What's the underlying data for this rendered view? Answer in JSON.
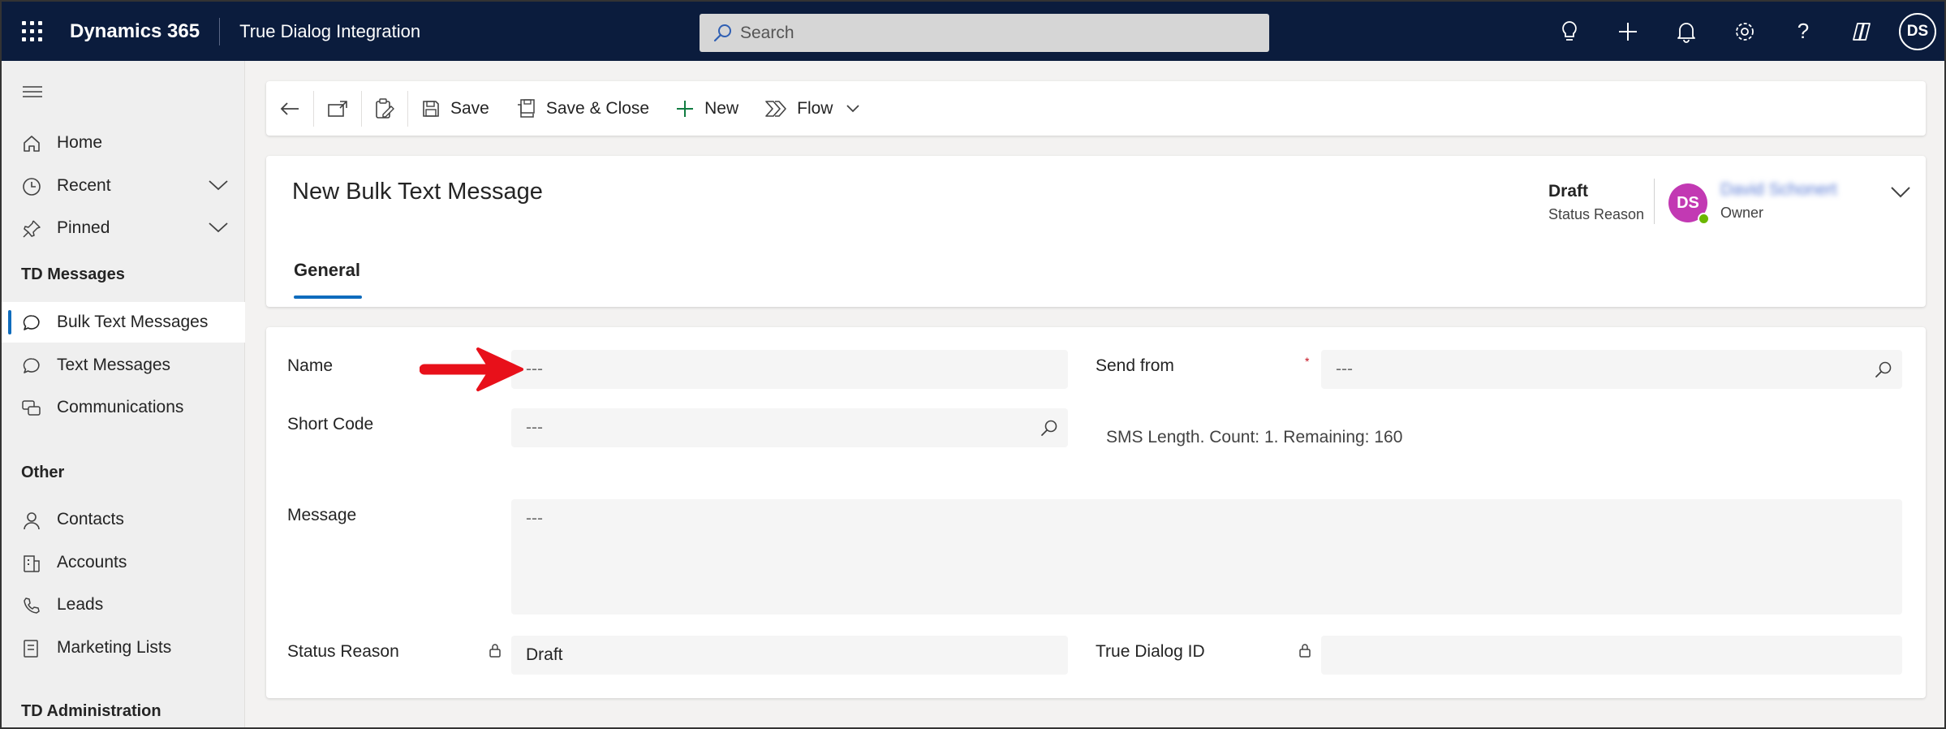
{
  "topbar": {
    "brand": "Dynamics 365",
    "app_name": "True Dialog Integration",
    "search_placeholder": "Search",
    "user_initials": "DS"
  },
  "sidebar": {
    "home": "Home",
    "recent": "Recent",
    "pinned": "Pinned",
    "group_td_messages": "TD Messages",
    "bulk_text_messages": "Bulk Text Messages",
    "text_messages": "Text Messages",
    "communications": "Communications",
    "group_other": "Other",
    "contacts": "Contacts",
    "accounts": "Accounts",
    "leads": "Leads",
    "marketing_lists": "Marketing Lists",
    "group_td_admin": "TD Administration"
  },
  "commandbar": {
    "save": "Save",
    "save_close": "Save & Close",
    "new": "New",
    "flow": "Flow"
  },
  "header": {
    "title": "New Bulk Text Message",
    "status_value": "Draft",
    "status_label": "Status Reason",
    "owner_initials": "DS",
    "owner_name": "David Schonert",
    "owner_label": "Owner",
    "tab_general": "General"
  },
  "form": {
    "name_label": "Name",
    "name_value": "---",
    "send_from_label": "Send from",
    "send_from_value": "---",
    "short_code_label": "Short Code",
    "short_code_value": "---",
    "sms_length": "SMS Length. Count: 1. Remaining: 160",
    "message_label": "Message",
    "message_value": "---",
    "status_reason_label": "Status Reason",
    "status_reason_value": "Draft",
    "true_dialog_id_label": "True Dialog ID",
    "true_dialog_id_value": ""
  },
  "colors": {
    "topbar_bg": "#0b1c3d",
    "accent": "#0f6cbd",
    "owner_avatar": "#c239b3",
    "presence": "#6bb700",
    "arrow": "#e8101a"
  }
}
